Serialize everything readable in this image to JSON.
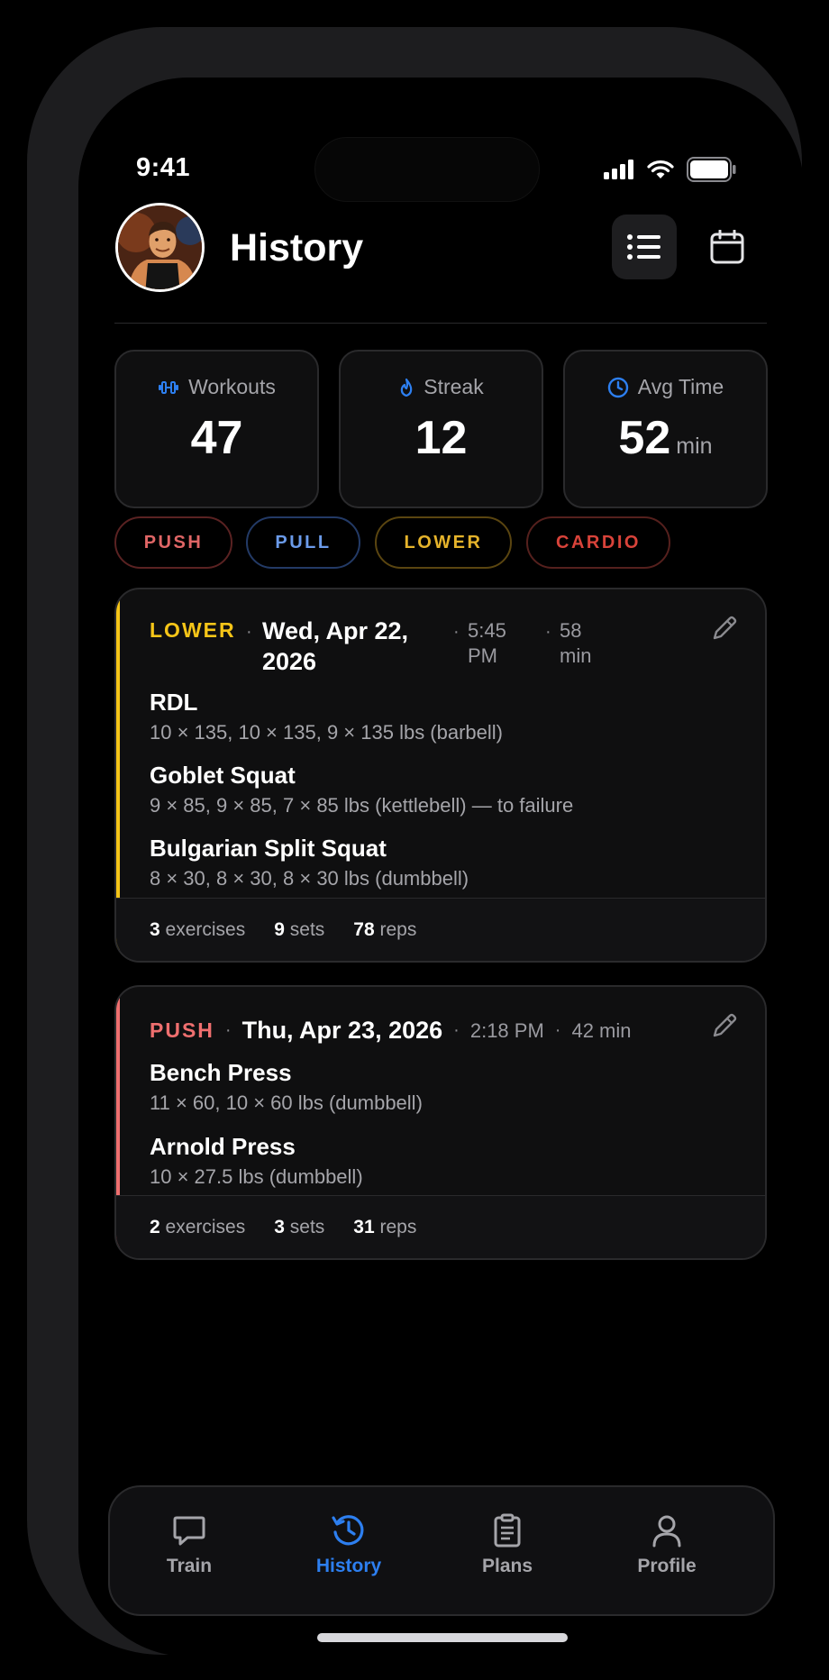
{
  "status_bar": {
    "time": "9:41"
  },
  "header": {
    "title": "History"
  },
  "stats": [
    {
      "label": "Workouts",
      "value": "47",
      "unit": "",
      "icon": "dumbbell-icon",
      "color": "#2d7ff0"
    },
    {
      "label": "Streak",
      "value": "12",
      "unit": "",
      "icon": "flame-icon",
      "color": "#2d7ff0"
    },
    {
      "label": "Avg Time",
      "value": "52",
      "unit": "min",
      "icon": "clock-icon",
      "color": "#2d7ff0"
    }
  ],
  "filters": [
    {
      "label": "PUSH",
      "color": "#e06666"
    },
    {
      "label": "PULL",
      "color": "#6b9bea"
    },
    {
      "label": "LOWER",
      "color": "#e5b32b"
    },
    {
      "label": "CARDIO",
      "color": "#d9433a"
    }
  ],
  "workouts": [
    {
      "tag": "LOWER",
      "tag_color": "#f5c518",
      "date_line1": "Wed, Apr 22,",
      "date_line2": "2026",
      "time_line1": "5:45",
      "time_line2": "PM",
      "duration_line1": "58",
      "duration_line2": "min",
      "exercises": [
        {
          "name": "RDL",
          "detail": "10 × 135, 10 × 135, 9 × 135 lbs (barbell)"
        },
        {
          "name": "Goblet Squat",
          "detail": "9 × 85, 9 × 85, 7 × 85 lbs (kettlebell) — to failure"
        },
        {
          "name": "Bulgarian Split Squat",
          "detail": "8 × 30, 8 × 30, 8 × 30 lbs (dumbbell)"
        }
      ],
      "summary": {
        "exercises": "3",
        "exercises_label": "exercises",
        "sets": "9",
        "sets_label": "sets",
        "reps": "78",
        "reps_label": "reps"
      }
    },
    {
      "tag": "PUSH",
      "tag_color": "#ef6f6f",
      "date": "Thu, Apr 23, 2026",
      "time": "2:18 PM",
      "duration": "42 min",
      "exercises": [
        {
          "name": "Bench Press",
          "detail": "11 × 60, 10 × 60 lbs (dumbbell)"
        },
        {
          "name": "Arnold Press",
          "detail": "10 × 27.5 lbs (dumbbell)"
        }
      ],
      "summary": {
        "exercises": "2",
        "exercises_label": "exercises",
        "sets": "3",
        "sets_label": "sets",
        "reps": "31",
        "reps_label": "reps"
      }
    }
  ],
  "tabs": [
    {
      "label": "Train",
      "icon": "chat-icon",
      "active": false
    },
    {
      "label": "History",
      "icon": "history-icon",
      "active": true
    },
    {
      "label": "Plans",
      "icon": "clipboard-icon",
      "active": false
    },
    {
      "label": "Profile",
      "icon": "person-icon",
      "active": false
    }
  ],
  "colors": {
    "accent": "#2d7ff0",
    "background": "#000000",
    "card": "#0f0f10"
  }
}
